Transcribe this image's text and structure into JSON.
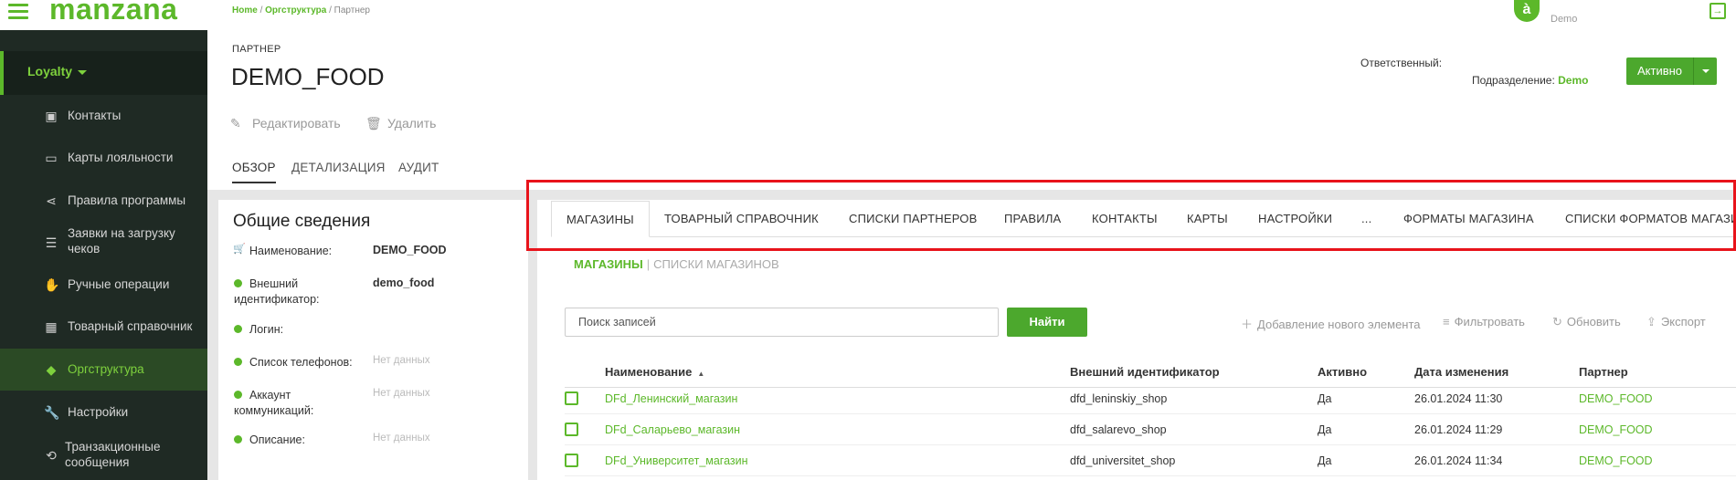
{
  "app": {
    "logo": "manzana",
    "user_initial": "à",
    "user_name": "Demo"
  },
  "breadcrumb": [
    "Home",
    "Оргструктура",
    "Партнер"
  ],
  "sidebar": {
    "section": "Loyalty",
    "items": [
      {
        "label": "Контакты",
        "icon": "contact-card-icon"
      },
      {
        "label": "Карты лояльности",
        "icon": "credit-card-icon"
      },
      {
        "label": "Правила программы",
        "icon": "share-nodes-icon"
      },
      {
        "label": "Заявки на загрузку чеков",
        "icon": "document-list-icon"
      },
      {
        "label": "Ручные операции",
        "icon": "hand-icon"
      },
      {
        "label": "Товарный справочник",
        "icon": "grid-icon"
      },
      {
        "label": "Оргструктура",
        "icon": "layers-icon"
      },
      {
        "label": "Настройки",
        "icon": "wrench-icon"
      },
      {
        "label": "Транзакционные сообщения",
        "icon": "sync-icon"
      }
    ]
  },
  "page": {
    "label": "ПАРТНЕР",
    "title": "DEMO_FOOD",
    "responsible_label": "Ответственный:",
    "department_label": "Подразделение:",
    "department_value": "Demo",
    "status": "Активно",
    "actions": {
      "edit": "Редактировать",
      "delete": "Удалить"
    },
    "tabs": [
      "ОБЗОР",
      "ДЕТАЛИЗАЦИЯ",
      "АУДИТ"
    ]
  },
  "info": {
    "title": "Общие сведения",
    "rows": [
      {
        "key": "Наименование:",
        "value": "DEMO_FOOD"
      },
      {
        "key": "Внешний идентификатор:",
        "value": "demo_food"
      },
      {
        "key": "Логин:",
        "value": ""
      },
      {
        "key": "Список телефонов:",
        "value": "Нет данных"
      },
      {
        "key": "Аккаунт коммуникаций:",
        "value": "Нет данных"
      },
      {
        "key": "Описание:",
        "value": "Нет данных"
      }
    ]
  },
  "subtabs": [
    "МАГАЗИНЫ",
    "ТОВАРНЫЙ СПРАВОЧНИК",
    "СПИСКИ ПАРТНЕРОВ",
    "ПРАВИЛА",
    "КОНТАКТЫ",
    "КАРТЫ",
    "НАСТРОЙКИ",
    "...",
    "ФОРМАТЫ МАГАЗИНА",
    "СПИСКИ ФОРМАТОВ МАГАЗИ"
  ],
  "sections": [
    "МАГАЗИНЫ",
    "СПИСКИ МАГАЗИНОВ"
  ],
  "search": {
    "placeholder": "Поиск записей",
    "button": "Найти"
  },
  "toolbar": {
    "add": "Добавление нового элемента",
    "filter": "Фильтровать",
    "refresh": "Обновить",
    "export": "Экспорт"
  },
  "table": {
    "columns": [
      "Наименование",
      "Внешний идентификатор",
      "Активно",
      "Дата изменения",
      "Партнер"
    ],
    "rows": [
      [
        "DFd_Ленинский_магазин",
        "dfd_leninskiy_shop",
        "Да",
        "26.01.2024 11:30",
        "DEMO_FOOD"
      ],
      [
        "DFd_Саларьево_магазин",
        "dfd_salarevo_shop",
        "Да",
        "26.01.2024 11:29",
        "DEMO_FOOD"
      ],
      [
        "DFd_Университет_магазин",
        "dfd_universitet_shop",
        "Да",
        "26.01.2024 11:34",
        "DEMO_FOOD"
      ]
    ]
  },
  "colors": {
    "accent": "#5cb82a",
    "sidebar_bg": "#1f2a24",
    "highlight": "#e8131b"
  }
}
